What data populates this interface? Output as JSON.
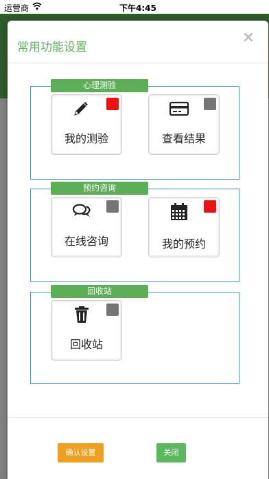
{
  "statusbar": {
    "carrier": "运营商",
    "time": "下午4:45"
  },
  "modal": {
    "title": "常用功能设置",
    "close_symbol": "×"
  },
  "groups": [
    {
      "label": "心理测验",
      "tiles": [
        {
          "label": "我的测验",
          "icon": "pencil-icon",
          "enabled": true
        },
        {
          "label": "查看结果",
          "icon": "credit-card-icon",
          "enabled": false
        }
      ]
    },
    {
      "label": "预约咨询",
      "tiles": [
        {
          "label": "在线咨询",
          "icon": "chat-bubbles-icon",
          "enabled": false
        },
        {
          "label": "我的预约",
          "icon": "calendar-icon",
          "enabled": true
        }
      ]
    },
    {
      "label": "回收站",
      "tiles": [
        {
          "label": "回收站",
          "icon": "trash-icon",
          "enabled": false
        }
      ]
    }
  ],
  "footer": {
    "confirm_label": "确认设置",
    "close_label": "关闭"
  },
  "colors": {
    "title_green": "#5cb85c",
    "group_border": "#3a9bd5",
    "toggle_on": "#ee1111",
    "toggle_off": "#757575",
    "confirm_orange": "#f0a020"
  }
}
